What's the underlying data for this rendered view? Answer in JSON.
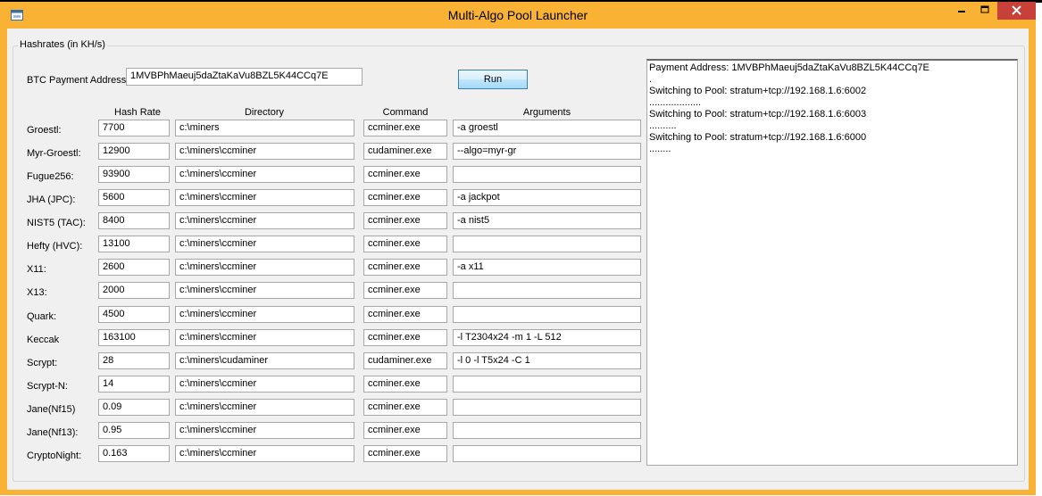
{
  "window": {
    "title": "Multi-Algo Pool Launcher"
  },
  "group": {
    "label": "Hashrates (in KH/s)"
  },
  "payment": {
    "label": "BTC Payment Address:",
    "value": "1MVBPhMaeuj5daZtaKaVu8BZL5K44CCq7E"
  },
  "run_label": "Run",
  "headers": {
    "hashrate": "Hash Rate",
    "directory": "Directory",
    "command": "Command",
    "arguments": "Arguments"
  },
  "rows": [
    {
      "algo": "Groestl:",
      "rate": "7700",
      "dir": "c:\\miners",
      "cmd": "ccminer.exe",
      "args": "-a groestl"
    },
    {
      "algo": "Myr-Groestl:",
      "rate": "12900",
      "dir": "c:\\miners\\ccminer",
      "cmd": "cudaminer.exe",
      "args": "--algo=myr-gr"
    },
    {
      "algo": "Fugue256:",
      "rate": "93900",
      "dir": "c:\\miners\\ccminer",
      "cmd": "ccminer.exe",
      "args": ""
    },
    {
      "algo": "JHA (JPC):",
      "rate": "5600",
      "dir": "c:\\miners\\ccminer",
      "cmd": "ccminer.exe",
      "args": "-a jackpot"
    },
    {
      "algo": "NIST5 (TAC):",
      "rate": "8400",
      "dir": "c:\\miners\\ccminer",
      "cmd": "ccminer.exe",
      "args": "-a nist5"
    },
    {
      "algo": "Hefty (HVC):",
      "rate": "13100",
      "dir": "c:\\miners\\ccminer",
      "cmd": "ccminer.exe",
      "args": ""
    },
    {
      "algo": "X11:",
      "rate": "2600",
      "dir": "c:\\miners\\ccminer",
      "cmd": "ccminer.exe",
      "args": "-a x11"
    },
    {
      "algo": "X13:",
      "rate": "2000",
      "dir": "c:\\miners\\ccminer",
      "cmd": "ccminer.exe",
      "args": ""
    },
    {
      "algo": "Quark:",
      "rate": "4500",
      "dir": "c:\\miners\\ccminer",
      "cmd": "ccminer.exe",
      "args": ""
    },
    {
      "algo": "Keccak",
      "rate": "163100",
      "dir": "c:\\miners\\ccminer",
      "cmd": "ccminer.exe",
      "args": "-l T2304x24 -m 1 -L 512"
    },
    {
      "algo": "Scrypt:",
      "rate": "28",
      "dir": "c:\\miners\\cudaminer",
      "cmd": "cudaminer.exe",
      "args": "-l 0 -l T5x24 -C 1"
    },
    {
      "algo": "Scrypt-N:",
      "rate": "14",
      "dir": "c:\\miners\\ccminer",
      "cmd": "ccminer.exe",
      "args": ""
    },
    {
      "algo": "Jane(Nf15)",
      "rate": "0.09",
      "dir": "c:\\miners\\ccminer",
      "cmd": "ccminer.exe",
      "args": ""
    },
    {
      "algo": "Jane(Nf13):",
      "rate": "0.95",
      "dir": "c:\\miners\\ccminer",
      "cmd": "ccminer.exe",
      "args": ""
    },
    {
      "algo": "CryptoNight:",
      "rate": "0.163",
      "dir": "c:\\miners\\ccminer",
      "cmd": "ccminer.exe",
      "args": ""
    }
  ],
  "log": [
    "Payment Address: 1MVBPhMaeuj5daZtaKaVu8BZL5K44CCq7E",
    ".",
    "Switching to Pool: stratum+tcp://192.168.1.6:6002",
    "...................",
    "Switching to Pool: stratum+tcp://192.168.1.6:6003",
    "..........",
    "Switching to Pool: stratum+tcp://192.168.1.6:6000",
    "........"
  ],
  "colors": {
    "title_bar": "#f9b233",
    "close": "#c7403a",
    "client_bg": "#f0f0f0"
  }
}
